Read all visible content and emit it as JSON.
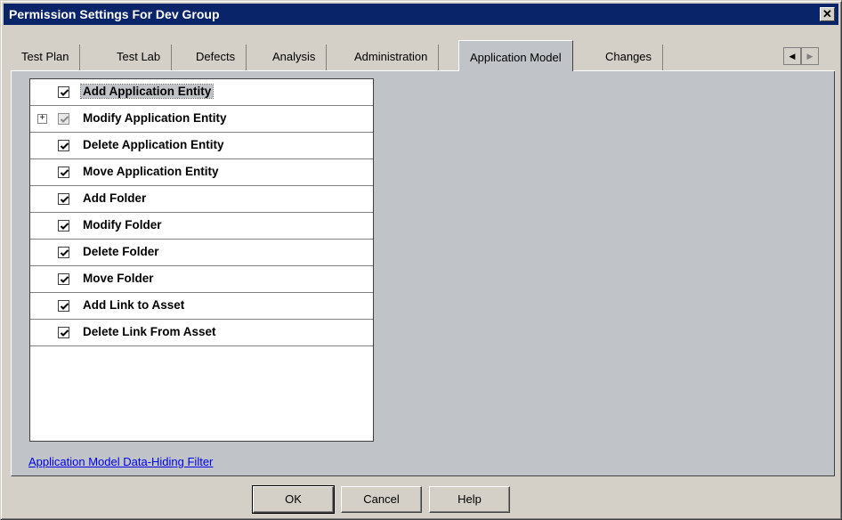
{
  "window": {
    "title": "Permission Settings For Dev Group",
    "close_glyph": "✕"
  },
  "tabs": [
    {
      "label": "Test Plan"
    },
    {
      "label": "Test Lab"
    },
    {
      "label": "Defects"
    },
    {
      "label": "Analysis"
    },
    {
      "label": "Administration"
    },
    {
      "label": "Application Model",
      "active": true
    },
    {
      "label": "Changes"
    }
  ],
  "tab_scroll": {
    "left_glyph": "◀",
    "right_glyph": "▶"
  },
  "permissions": [
    {
      "label": "Add Application Entity",
      "checked": true,
      "selected": true
    },
    {
      "label": "Modify Application Entity",
      "checked": true,
      "partial": true,
      "expandable": true,
      "expander_glyph": "+"
    },
    {
      "label": "Delete Application Entity",
      "checked": true
    },
    {
      "label": "Move Application Entity",
      "checked": true
    },
    {
      "label": "Add Folder",
      "checked": true
    },
    {
      "label": "Modify Folder",
      "checked": true
    },
    {
      "label": "Delete Folder",
      "checked": true
    },
    {
      "label": "Move Folder",
      "checked": true
    },
    {
      "label": "Add Link to Asset",
      "checked": true
    },
    {
      "label": "Delete Link From Asset",
      "checked": true
    }
  ],
  "filter_link": "Application Model Data-Hiding Filter",
  "buttons": {
    "ok": "OK",
    "cancel": "Cancel",
    "help": "Help"
  }
}
